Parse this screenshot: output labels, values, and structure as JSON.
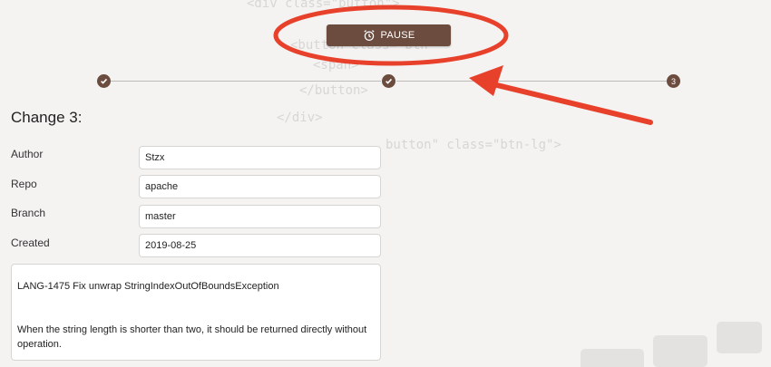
{
  "toolbar": {
    "pause_label": "PAUSE",
    "icon": "alarm-clock-icon"
  },
  "stepper": {
    "steps": [
      {
        "state": "done",
        "icon": "check-icon"
      },
      {
        "state": "done",
        "icon": "check-icon"
      },
      {
        "state": "current",
        "label": "3"
      }
    ]
  },
  "change": {
    "title": "Change 3:",
    "fields": [
      {
        "label": "Author",
        "value": "Stzx"
      },
      {
        "label": "Repo",
        "value": "apache"
      },
      {
        "label": "Branch",
        "value": "master"
      },
      {
        "label": "Created",
        "value": "2019-08-25"
      }
    ],
    "message_summary": "LANG-1475 Fix unwrap StringIndexOutOfBoundsException",
    "message_body": "When the string length is shorter than two, it should be returned directly without operation."
  },
  "colors": {
    "accent": "#6b4c3f",
    "annotation": "#e8412b",
    "background": "#f4f3f2"
  }
}
